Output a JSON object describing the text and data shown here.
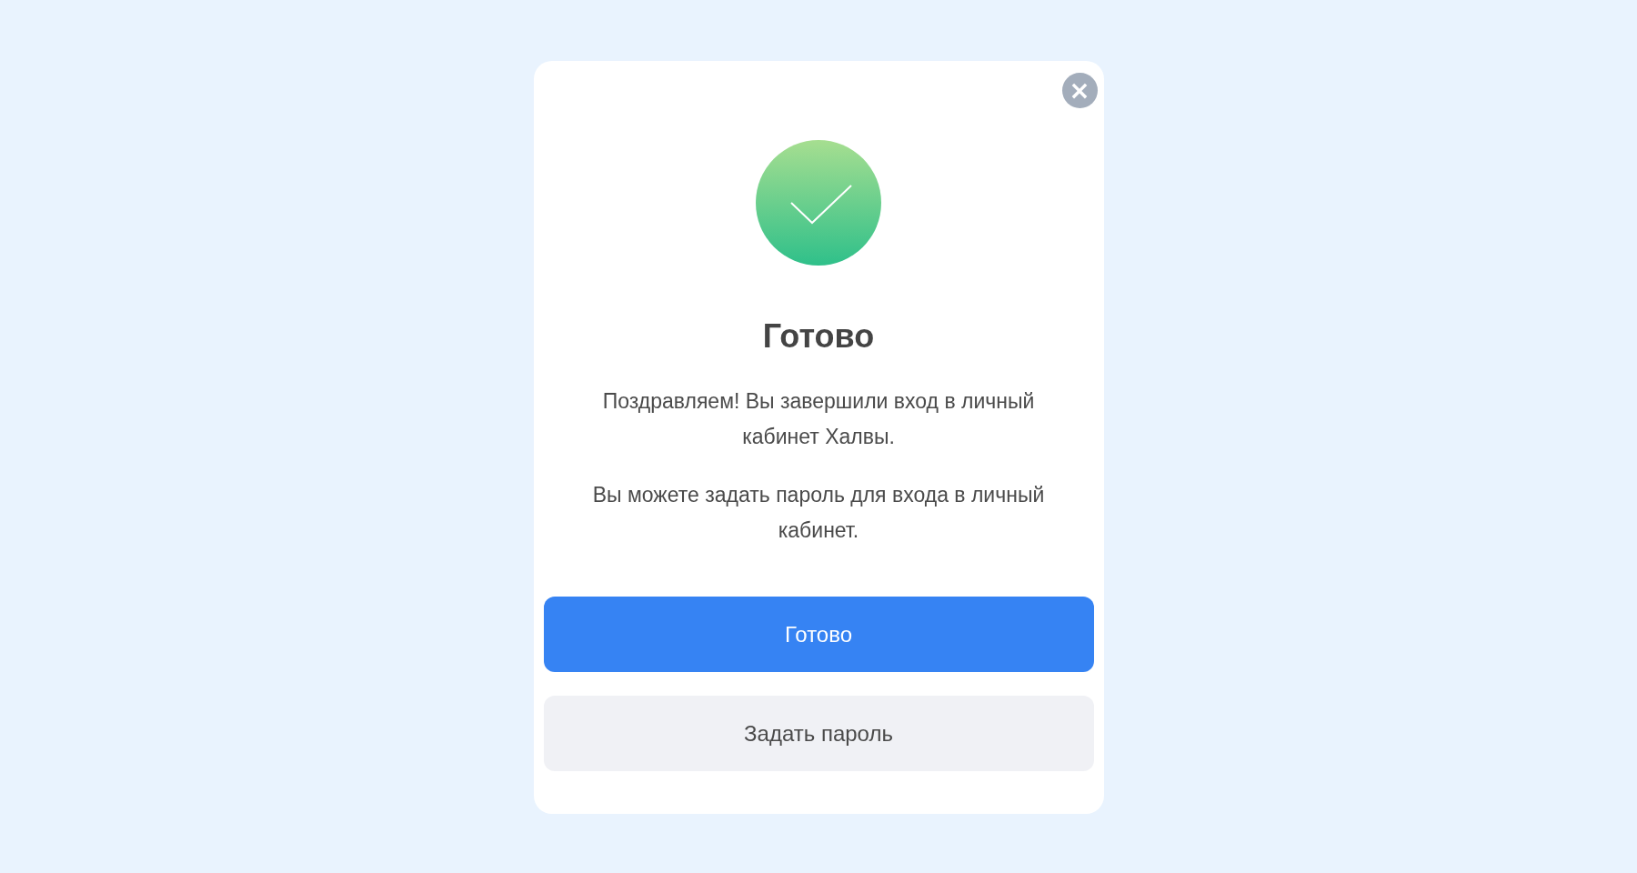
{
  "dialog": {
    "close": "×",
    "success": true,
    "title": "Готово",
    "paragraphs": [
      "Поздравляем! Вы завершили вход в личный кабинет Халвы.",
      "Вы можете задать пароль для входа в личный кабинет."
    ],
    "buttons": [
      {
        "label": "Готово",
        "kind": "primary"
      },
      {
        "label": "Задать пароль",
        "kind": "secondary"
      }
    ]
  }
}
